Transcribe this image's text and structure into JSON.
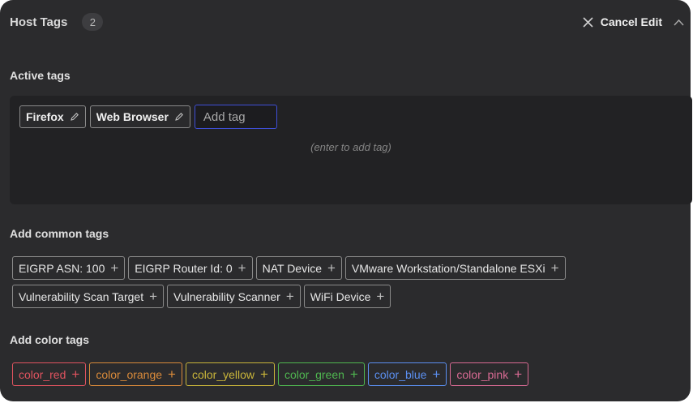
{
  "header": {
    "title": "Host Tags",
    "count": "2",
    "cancel_label": "Cancel Edit"
  },
  "active": {
    "label": "Active tags",
    "tags": [
      "Firefox",
      "Web Browser"
    ],
    "input_placeholder": "Add tag",
    "hint": "(enter to add tag)"
  },
  "common": {
    "label": "Add common tags",
    "tags": [
      "EIGRP ASN: 100",
      "EIGRP Router Id: 0",
      "NAT Device",
      "VMware Workstation/Standalone ESXi",
      "Vulnerability Scan Target",
      "Vulnerability Scanner",
      "WiFi Device"
    ]
  },
  "color": {
    "label": "Add color tags",
    "tags": [
      {
        "label": "color_red",
        "color": "#e0535f"
      },
      {
        "label": "color_orange",
        "color": "#d98a3a"
      },
      {
        "label": "color_yellow",
        "color": "#c9b53a"
      },
      {
        "label": "color_green",
        "color": "#4fb650"
      },
      {
        "label": "color_blue",
        "color": "#5b8ff0"
      },
      {
        "label": "color_pink",
        "color": "#d86a93"
      }
    ]
  },
  "symbols": {
    "plus": "+"
  }
}
